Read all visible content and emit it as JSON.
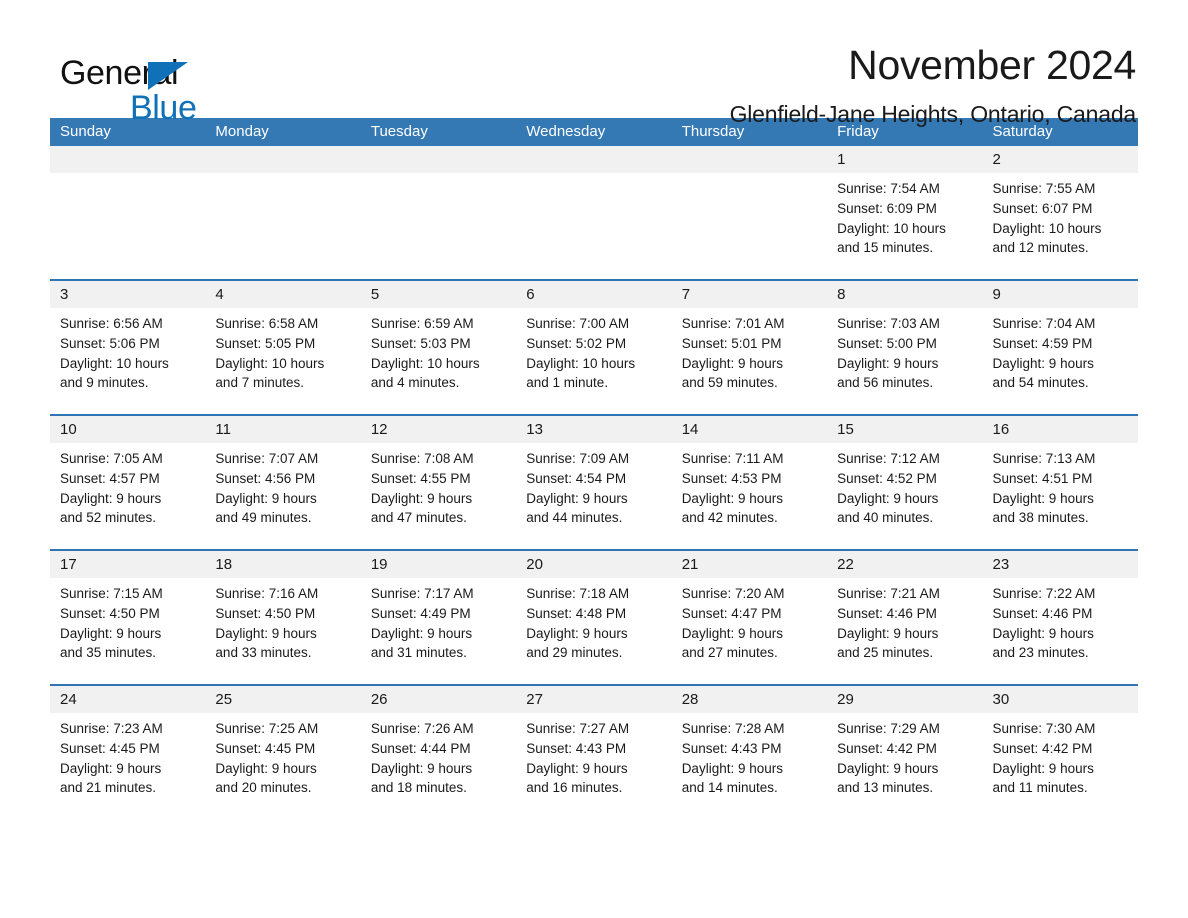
{
  "brand": {
    "name_part1": "General",
    "name_part2": "Blue",
    "triangle_icon": "brand-triangle-icon",
    "accent_color": "#1071B8"
  },
  "header": {
    "title": "November 2024",
    "subtitle": "Glenfield-Jane Heights, Ontario, Canada"
  },
  "colors": {
    "header_blue": "#3478B4",
    "row_divider_blue": "#2E75B6",
    "day_band_gray": "#F1F1F1"
  },
  "calendar": {
    "weekday_headers": [
      "Sunday",
      "Monday",
      "Tuesday",
      "Wednesday",
      "Thursday",
      "Friday",
      "Saturday"
    ],
    "weeks": [
      [
        {
          "day": "",
          "sunrise": "",
          "sunset": "",
          "daylight_line1": "",
          "daylight_line2": "",
          "empty": true
        },
        {
          "day": "",
          "sunrise": "",
          "sunset": "",
          "daylight_line1": "",
          "daylight_line2": "",
          "empty": true
        },
        {
          "day": "",
          "sunrise": "",
          "sunset": "",
          "daylight_line1": "",
          "daylight_line2": "",
          "empty": true
        },
        {
          "day": "",
          "sunrise": "",
          "sunset": "",
          "daylight_line1": "",
          "daylight_line2": "",
          "empty": true
        },
        {
          "day": "",
          "sunrise": "",
          "sunset": "",
          "daylight_line1": "",
          "daylight_line2": "",
          "empty": true
        },
        {
          "day": "1",
          "sunrise": "Sunrise: 7:54 AM",
          "sunset": "Sunset: 6:09 PM",
          "daylight_line1": "Daylight: 10 hours",
          "daylight_line2": "and 15 minutes."
        },
        {
          "day": "2",
          "sunrise": "Sunrise: 7:55 AM",
          "sunset": "Sunset: 6:07 PM",
          "daylight_line1": "Daylight: 10 hours",
          "daylight_line2": "and 12 minutes."
        }
      ],
      [
        {
          "day": "3",
          "sunrise": "Sunrise: 6:56 AM",
          "sunset": "Sunset: 5:06 PM",
          "daylight_line1": "Daylight: 10 hours",
          "daylight_line2": "and 9 minutes."
        },
        {
          "day": "4",
          "sunrise": "Sunrise: 6:58 AM",
          "sunset": "Sunset: 5:05 PM",
          "daylight_line1": "Daylight: 10 hours",
          "daylight_line2": "and 7 minutes."
        },
        {
          "day": "5",
          "sunrise": "Sunrise: 6:59 AM",
          "sunset": "Sunset: 5:03 PM",
          "daylight_line1": "Daylight: 10 hours",
          "daylight_line2": "and 4 minutes."
        },
        {
          "day": "6",
          "sunrise": "Sunrise: 7:00 AM",
          "sunset": "Sunset: 5:02 PM",
          "daylight_line1": "Daylight: 10 hours",
          "daylight_line2": "and 1 minute."
        },
        {
          "day": "7",
          "sunrise": "Sunrise: 7:01 AM",
          "sunset": "Sunset: 5:01 PM",
          "daylight_line1": "Daylight: 9 hours",
          "daylight_line2": "and 59 minutes."
        },
        {
          "day": "8",
          "sunrise": "Sunrise: 7:03 AM",
          "sunset": "Sunset: 5:00 PM",
          "daylight_line1": "Daylight: 9 hours",
          "daylight_line2": "and 56 minutes."
        },
        {
          "day": "9",
          "sunrise": "Sunrise: 7:04 AM",
          "sunset": "Sunset: 4:59 PM",
          "daylight_line1": "Daylight: 9 hours",
          "daylight_line2": "and 54 minutes."
        }
      ],
      [
        {
          "day": "10",
          "sunrise": "Sunrise: 7:05 AM",
          "sunset": "Sunset: 4:57 PM",
          "daylight_line1": "Daylight: 9 hours",
          "daylight_line2": "and 52 minutes."
        },
        {
          "day": "11",
          "sunrise": "Sunrise: 7:07 AM",
          "sunset": "Sunset: 4:56 PM",
          "daylight_line1": "Daylight: 9 hours",
          "daylight_line2": "and 49 minutes."
        },
        {
          "day": "12",
          "sunrise": "Sunrise: 7:08 AM",
          "sunset": "Sunset: 4:55 PM",
          "daylight_line1": "Daylight: 9 hours",
          "daylight_line2": "and 47 minutes."
        },
        {
          "day": "13",
          "sunrise": "Sunrise: 7:09 AM",
          "sunset": "Sunset: 4:54 PM",
          "daylight_line1": "Daylight: 9 hours",
          "daylight_line2": "and 44 minutes."
        },
        {
          "day": "14",
          "sunrise": "Sunrise: 7:11 AM",
          "sunset": "Sunset: 4:53 PM",
          "daylight_line1": "Daylight: 9 hours",
          "daylight_line2": "and 42 minutes."
        },
        {
          "day": "15",
          "sunrise": "Sunrise: 7:12 AM",
          "sunset": "Sunset: 4:52 PM",
          "daylight_line1": "Daylight: 9 hours",
          "daylight_line2": "and 40 minutes."
        },
        {
          "day": "16",
          "sunrise": "Sunrise: 7:13 AM",
          "sunset": "Sunset: 4:51 PM",
          "daylight_line1": "Daylight: 9 hours",
          "daylight_line2": "and 38 minutes."
        }
      ],
      [
        {
          "day": "17",
          "sunrise": "Sunrise: 7:15 AM",
          "sunset": "Sunset: 4:50 PM",
          "daylight_line1": "Daylight: 9 hours",
          "daylight_line2": "and 35 minutes."
        },
        {
          "day": "18",
          "sunrise": "Sunrise: 7:16 AM",
          "sunset": "Sunset: 4:50 PM",
          "daylight_line1": "Daylight: 9 hours",
          "daylight_line2": "and 33 minutes."
        },
        {
          "day": "19",
          "sunrise": "Sunrise: 7:17 AM",
          "sunset": "Sunset: 4:49 PM",
          "daylight_line1": "Daylight: 9 hours",
          "daylight_line2": "and 31 minutes."
        },
        {
          "day": "20",
          "sunrise": "Sunrise: 7:18 AM",
          "sunset": "Sunset: 4:48 PM",
          "daylight_line1": "Daylight: 9 hours",
          "daylight_line2": "and 29 minutes."
        },
        {
          "day": "21",
          "sunrise": "Sunrise: 7:20 AM",
          "sunset": "Sunset: 4:47 PM",
          "daylight_line1": "Daylight: 9 hours",
          "daylight_line2": "and 27 minutes."
        },
        {
          "day": "22",
          "sunrise": "Sunrise: 7:21 AM",
          "sunset": "Sunset: 4:46 PM",
          "daylight_line1": "Daylight: 9 hours",
          "daylight_line2": "and 25 minutes."
        },
        {
          "day": "23",
          "sunrise": "Sunrise: 7:22 AM",
          "sunset": "Sunset: 4:46 PM",
          "daylight_line1": "Daylight: 9 hours",
          "daylight_line2": "and 23 minutes."
        }
      ],
      [
        {
          "day": "24",
          "sunrise": "Sunrise: 7:23 AM",
          "sunset": "Sunset: 4:45 PM",
          "daylight_line1": "Daylight: 9 hours",
          "daylight_line2": "and 21 minutes."
        },
        {
          "day": "25",
          "sunrise": "Sunrise: 7:25 AM",
          "sunset": "Sunset: 4:45 PM",
          "daylight_line1": "Daylight: 9 hours",
          "daylight_line2": "and 20 minutes."
        },
        {
          "day": "26",
          "sunrise": "Sunrise: 7:26 AM",
          "sunset": "Sunset: 4:44 PM",
          "daylight_line1": "Daylight: 9 hours",
          "daylight_line2": "and 18 minutes."
        },
        {
          "day": "27",
          "sunrise": "Sunrise: 7:27 AM",
          "sunset": "Sunset: 4:43 PM",
          "daylight_line1": "Daylight: 9 hours",
          "daylight_line2": "and 16 minutes."
        },
        {
          "day": "28",
          "sunrise": "Sunrise: 7:28 AM",
          "sunset": "Sunset: 4:43 PM",
          "daylight_line1": "Daylight: 9 hours",
          "daylight_line2": "and 14 minutes."
        },
        {
          "day": "29",
          "sunrise": "Sunrise: 7:29 AM",
          "sunset": "Sunset: 4:42 PM",
          "daylight_line1": "Daylight: 9 hours",
          "daylight_line2": "and 13 minutes."
        },
        {
          "day": "30",
          "sunrise": "Sunrise: 7:30 AM",
          "sunset": "Sunset: 4:42 PM",
          "daylight_line1": "Daylight: 9 hours",
          "daylight_line2": "and 11 minutes."
        }
      ]
    ]
  }
}
